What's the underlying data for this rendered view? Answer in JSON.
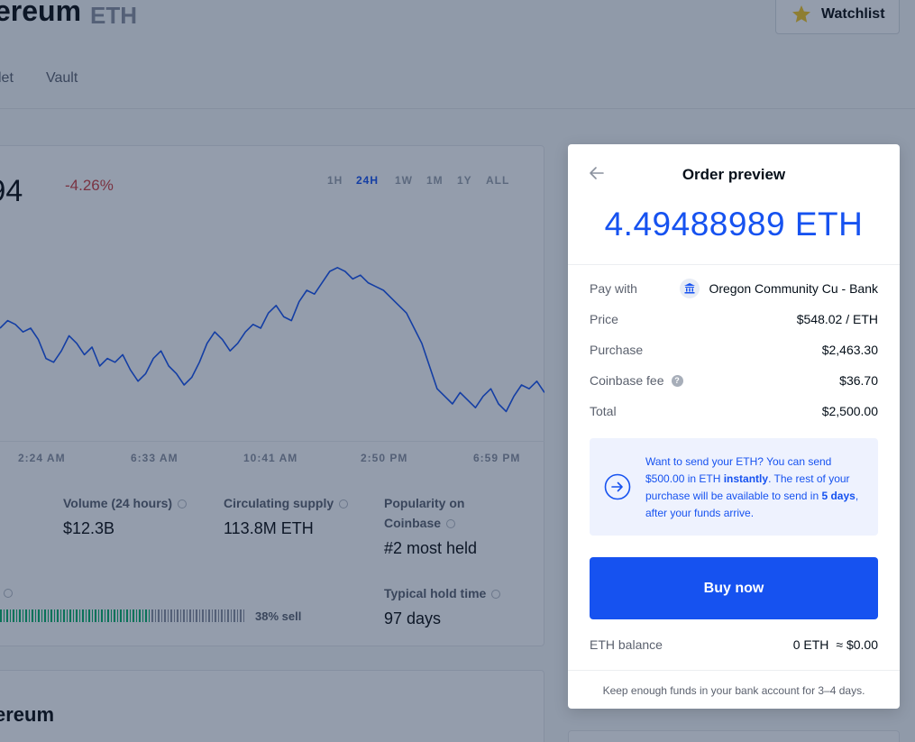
{
  "background": {
    "asset_name": "ereum",
    "asset_ticker": "ETH",
    "watchlist_label": "Watchlist",
    "tabs": [
      "let",
      "Vault"
    ],
    "price": ".94",
    "price_change": "-4.26%",
    "ranges": [
      "1H",
      "24H",
      "1W",
      "1M",
      "1Y",
      "ALL"
    ],
    "active_range": "24H",
    "time_labels": [
      "2:24 AM",
      "6:33 AM",
      "10:41 AM",
      "2:50 PM",
      "6:59 PM"
    ],
    "stats": {
      "volume_label": "Volume (24 hours)",
      "volume_value": "$12.3B",
      "supply_label": "Circulating supply",
      "supply_value": "113.8M ETH",
      "popularity_label_1": "Popularity on",
      "popularity_label_2": "Coinbase",
      "popularity_value": "#2 most held",
      "hold_label": "Typical hold time",
      "hold_value": "97 days",
      "sell_label": "38% sell",
      "buy_fraction": 0.62
    },
    "about_title": "ereum"
  },
  "chart_data": {
    "type": "line",
    "x": [
      "2:24 AM",
      "6:33 AM",
      "10:41 AM",
      "2:50 PM",
      "6:59 PM"
    ],
    "values": [
      80,
      82,
      81,
      79,
      80,
      77,
      72,
      71,
      74,
      78,
      76,
      73,
      75,
      70,
      72,
      71,
      73,
      69,
      66,
      68,
      72,
      74,
      70,
      68,
      65,
      67,
      71,
      76,
      79,
      77,
      74,
      76,
      79,
      81,
      80,
      84,
      86,
      83,
      82,
      87,
      90,
      89,
      92,
      95,
      96,
      95,
      93,
      94,
      92,
      91,
      90,
      88,
      86,
      84,
      80,
      76,
      70,
      64,
      62,
      60,
      63,
      61,
      59,
      62,
      64,
      60,
      58,
      62,
      65,
      64,
      66,
      63
    ],
    "ylim": [
      50,
      100
    ],
    "grid": false
  },
  "modal": {
    "title": "Order preview",
    "amount": "4.49488989 ETH",
    "rows": [
      {
        "label": "Pay with",
        "value": "Oregon Community Cu - Bank"
      },
      {
        "label": "Price",
        "value": "$548.02 / ETH"
      },
      {
        "label": "Purchase",
        "value": "$2,463.30"
      },
      {
        "label": "Coinbase fee",
        "value": "$36.70"
      },
      {
        "label": "Total",
        "value": "$2,500.00"
      }
    ],
    "notice": {
      "part1": "Want to send your ETH? You can send $500.00 in ETH ",
      "bold1": "instantly",
      "part2": ". The rest of your purchase will be available to send in ",
      "bold2": "5 days",
      "part3": ", after your funds arrive."
    },
    "buy_label": "Buy now",
    "balance_label": "ETH balance",
    "balance_eth": "0 ETH",
    "balance_usd": "≈ $0.00",
    "footer_note": "Keep enough funds in your bank account for 3–4 days.",
    "accent_color": "#1652f0"
  }
}
